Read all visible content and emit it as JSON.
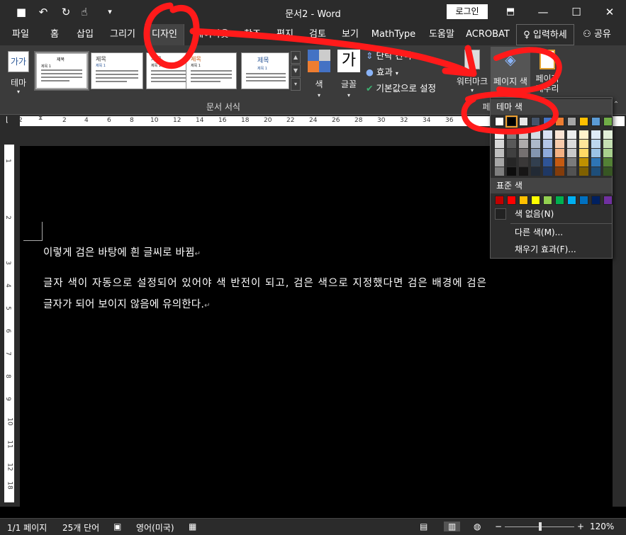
{
  "window": {
    "doc_name": "문서2",
    "sep": " - ",
    "app_name": "Word",
    "login_label": "로그인",
    "minimize": "—",
    "maximize": "☐",
    "close": "✕",
    "qat": {
      "save": "💾",
      "undo": "↶",
      "redo": "↻",
      "touch": "☝",
      "more": "▾"
    },
    "ribbon_display": "⬒"
  },
  "tabs": [
    "파일",
    "홈",
    "삽입",
    "그리기",
    "디자인",
    "레이아웃",
    "참조",
    "편지",
    "검토",
    "보기",
    "MathType",
    "도움말",
    "ACROBAT"
  ],
  "tell_me": "입력하세",
  "share": "공유",
  "ribbon": {
    "theme_label": "테마",
    "theme_icon_text": "가가",
    "thumbs": [
      {
        "title": "제목",
        "heading": "제목 1"
      },
      {
        "title": "제목",
        "heading": "제목 1"
      },
      {
        "title": "제목",
        "heading": "제목 1"
      },
      {
        "title": "제목",
        "heading": "제목 1"
      },
      {
        "title": "제목",
        "heading": "제목 1"
      }
    ],
    "colors_label": "색",
    "fonts_label": "글꼴",
    "fonts_icon": "가",
    "para_spacing": "단락 간격",
    "effects": "효과",
    "set_default": "기본값으로 설정",
    "group_doc_format": "문서 서식",
    "watermark": "워터마크",
    "page_color": "페이지 색",
    "page_border": "페이지 테두리",
    "group_bg": "페"
  },
  "ruler_h": [
    "2",
    "2",
    "4",
    "6",
    "8",
    "10",
    "12",
    "14",
    "16",
    "18",
    "20",
    "22",
    "24",
    "26",
    "28",
    "30",
    "32",
    "34",
    "36",
    "38"
  ],
  "ruler_v": [
    "1",
    "2",
    "3",
    "4",
    "5",
    "6",
    "7",
    "8",
    "9",
    "10",
    "11",
    "12",
    "13",
    "14",
    "15",
    "16",
    "17",
    "18"
  ],
  "document": {
    "line1": "이렇게 검은 바탕에 흰 글씨로 바뀜",
    "line2": "글자 색이 자동으로 설정되어 있어야 색 반전이 되고, 검은 색으로 지정했다면 검은 배경에 검은",
    "line3": "글자가 되어 보이지 않음에 유의한다.",
    "para_mark": "↵"
  },
  "dropdown": {
    "theme_colors": "테마 색",
    "standard_colors": "표준 색",
    "no_color": "색 없음(N)",
    "more_colors": "다른 색(M)...",
    "fill_effects": "채우기 효과(F)...",
    "theme_top": [
      "#ffffff",
      "#000000",
      "#e7e6e6",
      "#44546a",
      "#4472c4",
      "#ed7d31",
      "#a5a5a5",
      "#ffc000",
      "#5b9bd5",
      "#70ad47"
    ],
    "theme_shades": [
      [
        "#f2f2f2",
        "#808080",
        "#d0cece",
        "#d6dce4",
        "#d9e2f3",
        "#fbe5d5",
        "#ededed",
        "#fff2cc",
        "#deebf6",
        "#e2efd9"
      ],
      [
        "#d9d9d9",
        "#595959",
        "#aeabab",
        "#adb9ca",
        "#b4c6e7",
        "#f7cbac",
        "#dbdbdb",
        "#fee599",
        "#bdd7ee",
        "#c5e0b3"
      ],
      [
        "#bfbfbf",
        "#404040",
        "#757070",
        "#8496b0",
        "#8eaadb",
        "#f4b183",
        "#c9c9c9",
        "#ffd965",
        "#9cc3e5",
        "#a8d08d"
      ],
      [
        "#a6a6a6",
        "#262626",
        "#3a3838",
        "#323f4f",
        "#2f5496",
        "#c55a11",
        "#7b7b7b",
        "#bf9000",
        "#2e75b5",
        "#538135"
      ],
      [
        "#7f7f7f",
        "#0d0d0d",
        "#171616",
        "#222a35",
        "#1f3864",
        "#833c0b",
        "#525252",
        "#7f6000",
        "#1e4e79",
        "#375623"
      ]
    ],
    "standard": [
      "#c00000",
      "#ff0000",
      "#ffc000",
      "#ffff00",
      "#92d050",
      "#00b050",
      "#00b0f0",
      "#0070c0",
      "#002060",
      "#7030a0"
    ]
  },
  "status": {
    "page": "1/1 페이지",
    "words": "25개 단어",
    "lang": "영어(미국)",
    "zoom": "120%",
    "minus": "−",
    "plus": "+"
  }
}
